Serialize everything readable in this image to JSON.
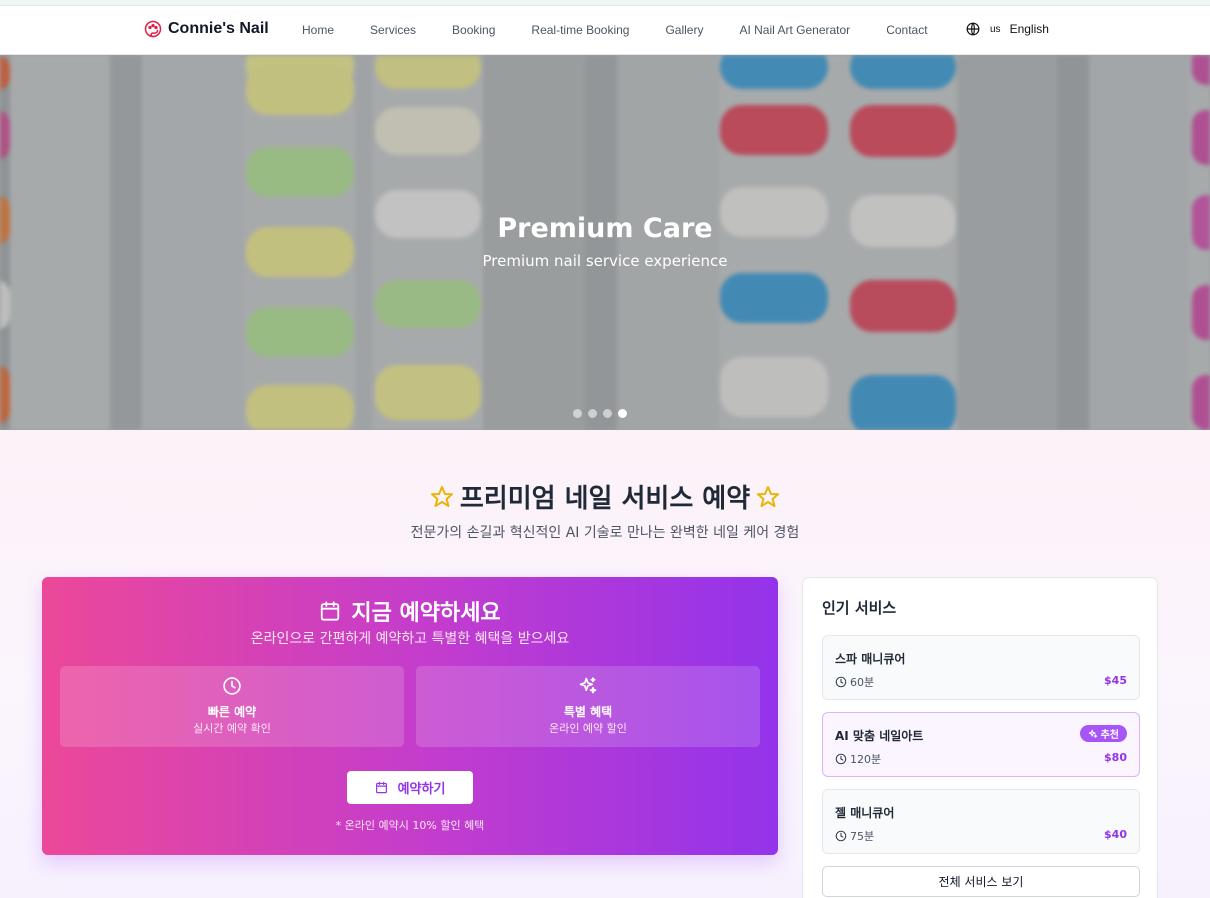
{
  "header": {
    "brand": "Connie's Nail",
    "nav": [
      "Home",
      "Services",
      "Booking",
      "Real-time Booking",
      "Gallery",
      "AI Nail Art Generator",
      "Contact"
    ],
    "lang_code": "us",
    "lang_name": "English"
  },
  "hero": {
    "title": "Premium Care",
    "subtitle": "Premium nail service experience",
    "slides": 4,
    "active_slide": 4
  },
  "section": {
    "title": "프리미엄 네일 서비스 예약",
    "subtitle": "전문가의 손길과 혁신적인 AI 기술로 만나는 완벽한 네일 케어 경험"
  },
  "booking": {
    "title": "지금 예약하세요",
    "subtitle": "온라인으로 간편하게 예약하고 특별한 혜택을 받으세요",
    "features": [
      {
        "icon": "clock-icon",
        "title": "빠른 예약",
        "desc": "실시간 예약 확인"
      },
      {
        "icon": "sparkles-icon",
        "title": "특별 혜택",
        "desc": "온라인 예약 할인"
      }
    ],
    "button": "예약하기",
    "note": "* 온라인 예약시 10% 할인 혜택"
  },
  "popular": {
    "title": "인기 서비스",
    "services": [
      {
        "name": "스파 매니큐어",
        "duration": "60분",
        "price": "$45"
      },
      {
        "name": "AI 맞춤 네일아트",
        "duration": "120분",
        "price": "$80",
        "badge": "추천"
      },
      {
        "name": "젤 매니큐어",
        "duration": "75분",
        "price": "$40"
      }
    ],
    "view_all": "전체 서비스 보기"
  },
  "colors": {
    "accent": "#9333ea",
    "pink": "#ec4899",
    "star": "#eab308"
  }
}
